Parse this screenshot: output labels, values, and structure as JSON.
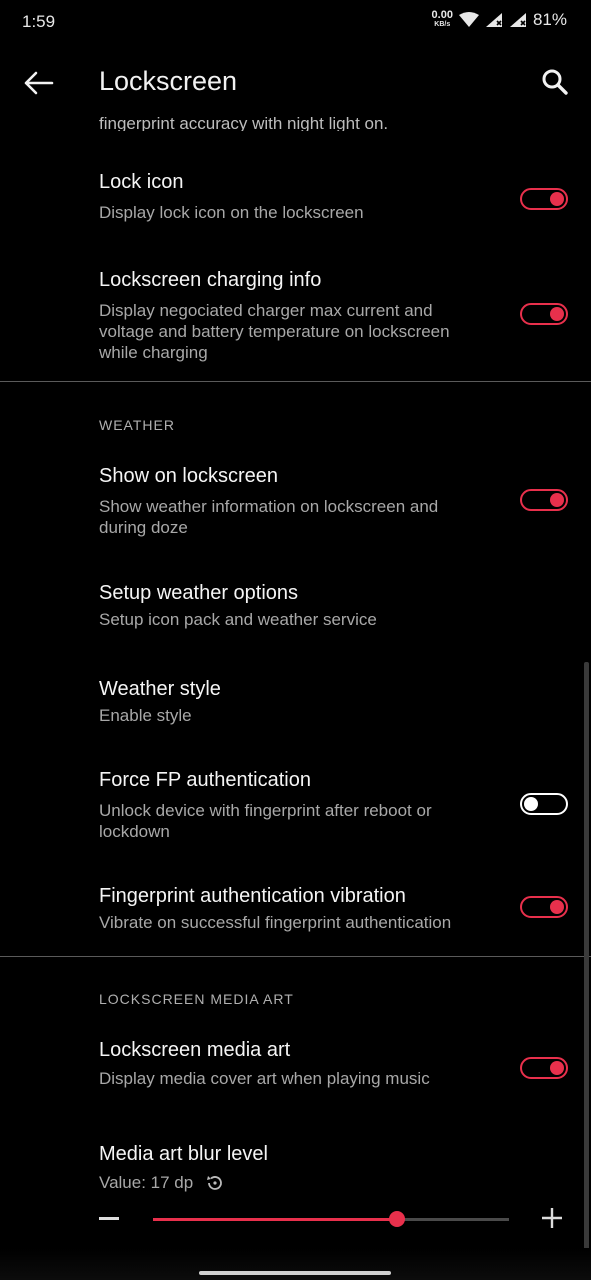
{
  "status_bar": {
    "time": "1:59",
    "net_speed_value": "0.00",
    "net_speed_unit": "KB/s",
    "battery": "81%"
  },
  "app_bar": {
    "title": "Lockscreen"
  },
  "cut_off_text": "fingerprint accuracy with night light on.",
  "prefs_top": [
    {
      "title": "Lock icon",
      "summary": "Display lock icon on the lockscreen",
      "toggle": "on"
    },
    {
      "title": "Lockscreen charging info",
      "summary_lines": [
        "Display negociated charger max current and",
        "voltage and battery temperature on lockscreen",
        "while charging"
      ],
      "toggle": "on"
    }
  ],
  "weather_section": {
    "header": "WEATHER",
    "items": [
      {
        "title": "Show on lockscreen",
        "summary_lines": [
          "Show weather information on lockscreen and",
          "during doze"
        ],
        "toggle": "on"
      },
      {
        "title": "Setup weather options",
        "summary": "Setup icon pack and weather service"
      },
      {
        "title": "Weather style",
        "summary": "Enable style"
      },
      {
        "title": "Force FP authentication",
        "summary_lines": [
          "Unlock device with fingerprint after reboot or",
          "lockdown"
        ],
        "toggle": "off"
      },
      {
        "title": "Fingerprint authentication vibration",
        "summary": "Vibrate on successful fingerprint authentication",
        "toggle": "on"
      }
    ]
  },
  "media_section": {
    "header": "LOCKSCREEN MEDIA ART",
    "items": [
      {
        "title": "Lockscreen media art",
        "summary": "Display media cover art when playing music",
        "toggle": "on"
      },
      {
        "title": "Media art blur level",
        "value_text": "Value: 17 dp"
      }
    ],
    "slider_fraction": 0.685
  },
  "colors": {
    "accent": "#e8304c",
    "background": "#000000"
  }
}
